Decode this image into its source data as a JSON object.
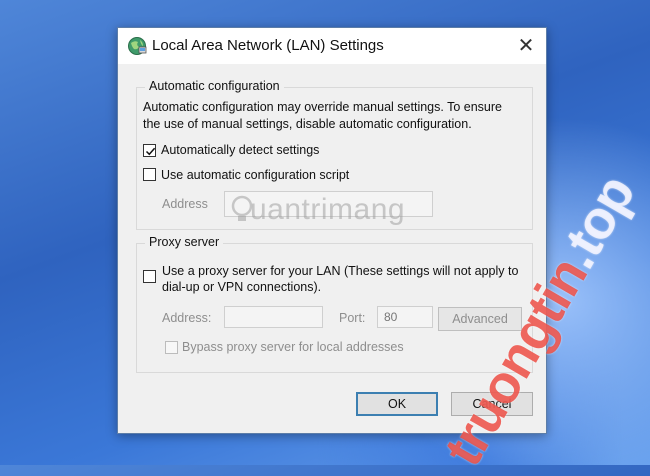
{
  "window": {
    "title": "Local Area Network (LAN) Settings",
    "close_symbol": "✕",
    "icon": "network-globe-icon"
  },
  "auto_config": {
    "legend": "Automatic configuration",
    "description_line1": "Automatic configuration may override manual settings.  To ensure",
    "description_line2": "the use of manual settings, disable automatic configuration.",
    "detect_label": "Automatically detect settings",
    "detect_checked": true,
    "script_label": "Use automatic configuration script",
    "script_checked": false,
    "address_label": "Address",
    "address_value": ""
  },
  "proxy": {
    "legend": "Proxy server",
    "use_proxy_line1": "Use a proxy server for your LAN (These settings will not apply to",
    "use_proxy_line2": "dial-up or VPN connections).",
    "use_proxy_checked": false,
    "address_label": "Address:",
    "address_value": "",
    "port_label": "Port:",
    "port_value": "80",
    "advanced_label": "Advanced",
    "bypass_label": "Bypass proxy server for local addresses",
    "bypass_checked": false
  },
  "buttons": {
    "ok_label": "OK",
    "cancel_label": "Cancel"
  },
  "watermarks": {
    "center_text": "uantrimang",
    "side_text_colored": "truongtin",
    "side_text_suffix": ".top"
  }
}
